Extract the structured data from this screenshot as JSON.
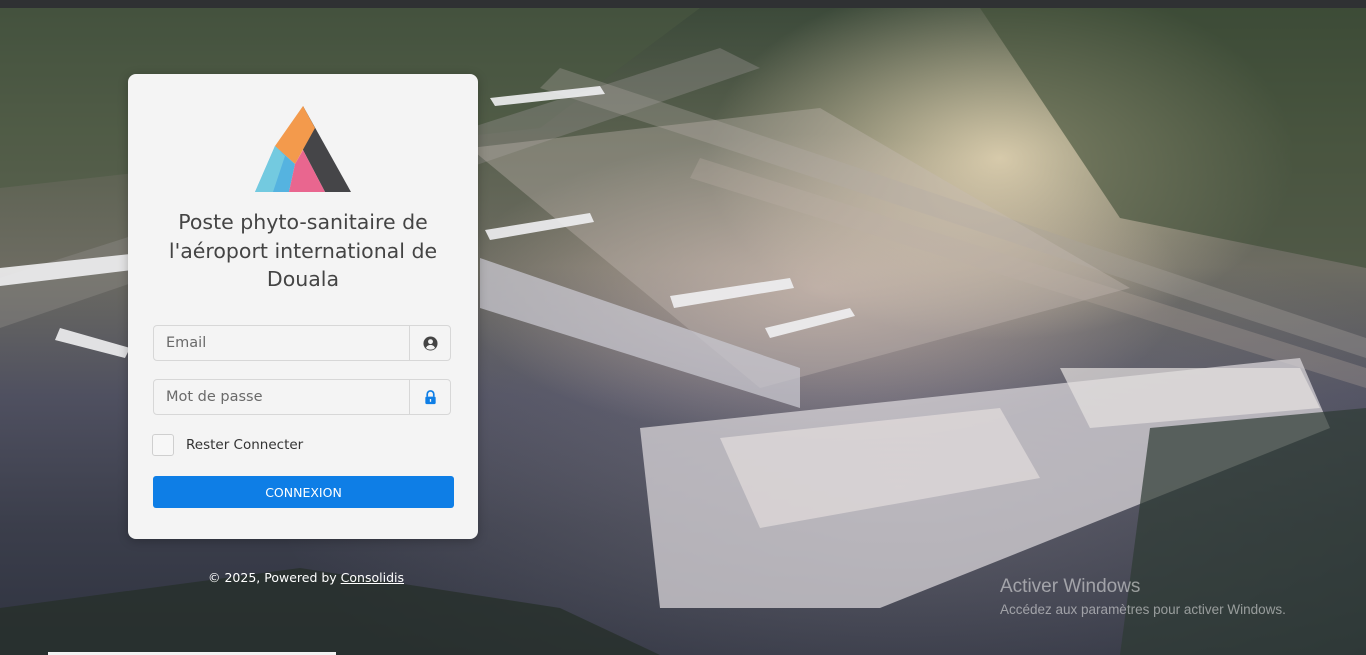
{
  "login": {
    "title": "Poste phyto-sanitaire de l'aéroport international de Douala",
    "email_placeholder": "Email",
    "password_placeholder": "Mot de passe",
    "remember_label": "Rester Connecter",
    "submit_label": "CONNEXION"
  },
  "footer": {
    "prefix": "© 2025, Powered by",
    "link_label": "Consolidis"
  },
  "watermark": {
    "title": "Activer Windows",
    "subtitle": "Accédez aux paramètres pour activer Windows."
  },
  "colors": {
    "primary_button": "#0e7ee6",
    "lock_icon": "#0e7ee6",
    "user_icon": "#444444",
    "logo_dark": "#454548",
    "logo_orange": "#f39a4c",
    "logo_blue": "#55b3e0",
    "logo_teal": "#7ad0e0",
    "logo_pink": "#e9668f"
  },
  "icons": {
    "email_addon": "user-circle-icon",
    "password_addon": "lock-icon"
  }
}
